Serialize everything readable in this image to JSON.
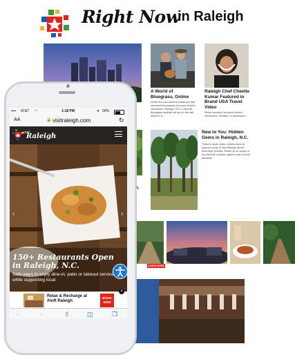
{
  "header": {
    "title_script": "Right Now",
    "title_plain": "in Raleigh"
  },
  "articles": [
    {
      "title": "A World of Bluegrass, Online",
      "desc": "While the coronavirus shutdown has canceled thousands of music events worldwide, Raleigh, N.C.'s annual bluegrass activity will go on this fall, albeit in a..."
    },
    {
      "title": "Raleigh Chef Cheetie Kumar Featured in Brand USA Travel Video",
      "desc": "Since opening her spice-driven restaurant, Garland, in downtown..."
    },
    {
      "title": "New to You: Hidden Gems in Raleigh, N.C.",
      "desc": "There's never been a better time to explore some of the Raleigh area's best-kept secrets. Read up on some of our favorite outdoor spaces and art that amazes!"
    }
  ],
  "partial_caption": "igh,",
  "learn_more": "LEARN MORE",
  "phone": {
    "status": {
      "carrier": "AT&T",
      "time": "1:18 PM",
      "battery": "56%"
    },
    "url_bar": {
      "text_size": "AA",
      "domain": "visitraleigh.com"
    },
    "site_logo": {
      "small": "visit",
      "big": "Raleigh"
    },
    "hero": {
      "headline": "150+ Restaurants Open in Raleigh, N.C.",
      "subtext": "Safe ways to enjoy dine-in, patio or takeout service while supporting local"
    },
    "ad": {
      "title": "Relax & Recharge at Aloft Raleigh",
      "cta": "BOOK NOW"
    }
  },
  "colors": {
    "brand_red": "#e2231a",
    "brand_blue": "#1f5aa6",
    "brand_green": "#3a9a3a",
    "brand_yellow": "#f2b41c",
    "accessibility_blue": "#1f78c8"
  }
}
